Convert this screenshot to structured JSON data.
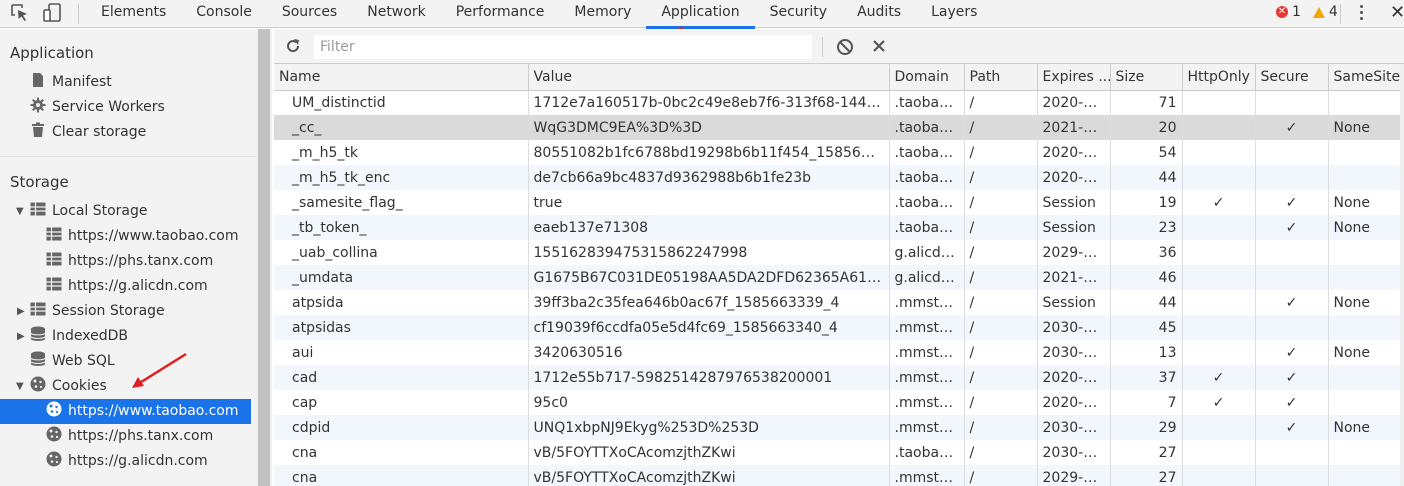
{
  "toolbar": {
    "tabs": [
      "Elements",
      "Console",
      "Sources",
      "Network",
      "Performance",
      "Memory",
      "Application",
      "Security",
      "Audits",
      "Layers"
    ],
    "active_tab": "Application",
    "error_count": "1",
    "warning_count": "4"
  },
  "sidebar": {
    "application_header": "Application",
    "app_items": [
      "Manifest",
      "Service Workers",
      "Clear storage"
    ],
    "storage_header": "Storage",
    "local_storage": "Local Storage",
    "local_storage_items": [
      "https://www.taobao.com",
      "https://phs.tanx.com",
      "https://g.alicdn.com"
    ],
    "session_storage": "Session Storage",
    "indexeddb": "IndexedDB",
    "websql": "Web SQL",
    "cookies": "Cookies",
    "cookie_items": [
      "https://www.taobao.com",
      "https://phs.tanx.com",
      "https://g.alicdn.com"
    ]
  },
  "filter": {
    "placeholder": "Filter"
  },
  "table": {
    "columns": [
      "Name",
      "Value",
      "Domain",
      "Path",
      "Expires ...",
      "Size",
      "HttpOnly",
      "Secure",
      "SameSite"
    ],
    "rows": [
      [
        "UM_distinctid",
        "1712e7a160517b-0bc2c49e8eb7f6-313f68-144000...",
        ".taobao...",
        "/",
        "2020-0...",
        "71",
        "",
        "",
        ""
      ],
      [
        "_cc_",
        "WqG3DMC9EA%3D%3D",
        ".taobao...",
        "/",
        "2021-0...",
        "20",
        "",
        "✓",
        "None"
      ],
      [
        "_m_h5_tk",
        "80551082b1fc6788bd19298b6b11f454_158566992...",
        ".taobao...",
        "/",
        "2020-0...",
        "54",
        "",
        "",
        ""
      ],
      [
        "_m_h5_tk_enc",
        "de7cb66a9bc4837d9362988b6b1fe23b",
        ".taobao...",
        "/",
        "2020-0...",
        "44",
        "",
        "",
        ""
      ],
      [
        "_samesite_flag_",
        "true",
        ".taobao...",
        "/",
        "Session",
        "19",
        "✓",
        "✓",
        "None"
      ],
      [
        "_tb_token_",
        "eaeb137e71308",
        ".taobao...",
        "/",
        "Session",
        "23",
        "",
        "✓",
        "None"
      ],
      [
        "_uab_collina",
        "155162839475315862247998",
        "g.alicdn...",
        "/",
        "2029-0...",
        "36",
        "",
        "",
        ""
      ],
      [
        "_umdata",
        "G1675B67C031DE05198AA5DA2DFD62365A61723",
        "g.alicdn...",
        "/",
        "2021-0...",
        "46",
        "",
        "",
        ""
      ],
      [
        "atpsida",
        "39ff3ba2c35fea646b0ac67f_1585663339_4",
        ".mmsta...",
        "/",
        "Session",
        "44",
        "",
        "✓",
        "None"
      ],
      [
        "atpsidas",
        "cf19039f6ccdfa05e5d4fc69_1585663340_4",
        ".mmsta...",
        "/",
        "2030-0...",
        "45",
        "",
        "",
        ""
      ],
      [
        "aui",
        "3420630516",
        ".mmsta...",
        "/",
        "2030-0...",
        "13",
        "",
        "✓",
        "None"
      ],
      [
        "cad",
        "1712e55b717-5982514287976538200001",
        ".mmsta...",
        "/",
        "2020-0...",
        "37",
        "✓",
        "✓",
        ""
      ],
      [
        "cap",
        "95c0",
        ".mmsta...",
        "/",
        "2020-0...",
        "7",
        "✓",
        "✓",
        ""
      ],
      [
        "cdpid",
        "UNQ1xbpNJ9Ekyg%253D%253D",
        ".mmsta...",
        "/",
        "2030-0...",
        "29",
        "",
        "✓",
        "None"
      ],
      [
        "cna",
        "vB/5FOYTTXoCAcomzjthZKwi",
        ".taobao...",
        "/",
        "2030-0...",
        "27",
        "",
        "",
        ""
      ],
      [
        "cna",
        "vB/5FOYTTXoCAcomzjthZKwi",
        ".mmsta...",
        "/",
        "2029-0...",
        "27",
        "",
        "",
        ""
      ]
    ]
  }
}
